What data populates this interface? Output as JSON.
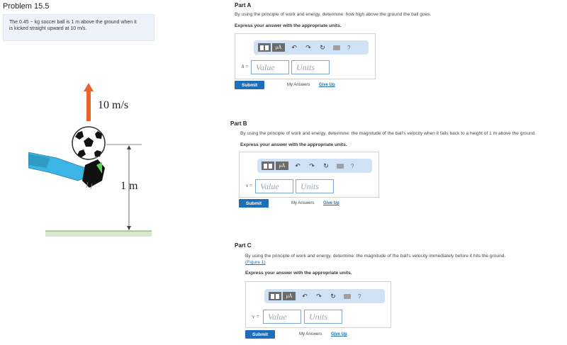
{
  "problem": {
    "title": "Problem 15.5",
    "statement_line1": "The 0.45 − kg soccer ball is 1 m above the ground when it",
    "statement_line2": "is kicked straight upward at 10 m/s."
  },
  "figure": {
    "velocity_label": "10 m/s",
    "height_label": "1 m"
  },
  "parts": [
    {
      "title": "Part A",
      "prompt": "By using the principle of work and energy, determine: how high above the ground the ball goes.",
      "express": "Express your answer with the appropriate units.",
      "variable": "h =",
      "value_placeholder": "Value",
      "units_placeholder": "Units",
      "submit": "Submit",
      "my_answers": "My Answers",
      "give_up": "Give Up"
    },
    {
      "title": "Part B",
      "prompt": "By using the principle of work and energy, determine: the magnitude of the ball's velocity when it falls back to a height of 1 m above the ground.",
      "express": "Express your answer with the appropriate units.",
      "variable": "v =",
      "value_placeholder": "Value",
      "units_placeholder": "Units",
      "submit": "Submit",
      "my_answers": "My Answers",
      "give_up": "Give Up"
    },
    {
      "title": "Part C",
      "prompt": "By using the principle of work and energy, determine: the magnitude of the ball's velocity immediately before it hits the ground.",
      "figure_link": "(Figure 1)",
      "express": "Express your answer with the appropriate units.",
      "variable": "v =",
      "value_placeholder": "Value",
      "units_placeholder": "Units",
      "submit": "Submit",
      "my_answers": "My Answers",
      "give_up": "Give Up"
    }
  ],
  "toolbar": {
    "mu_label": "μÅ",
    "help_label": "?",
    "icons": [
      "templates-icon",
      "units-icon",
      "undo-icon",
      "redo-icon",
      "reset-icon",
      "keyboard-icon",
      "help-icon"
    ]
  },
  "colors": {
    "submit": "#1f6fb8",
    "toolbar": "#cfe2f5",
    "problem_box": "#eef3fb",
    "arrow": "#e8632b"
  }
}
